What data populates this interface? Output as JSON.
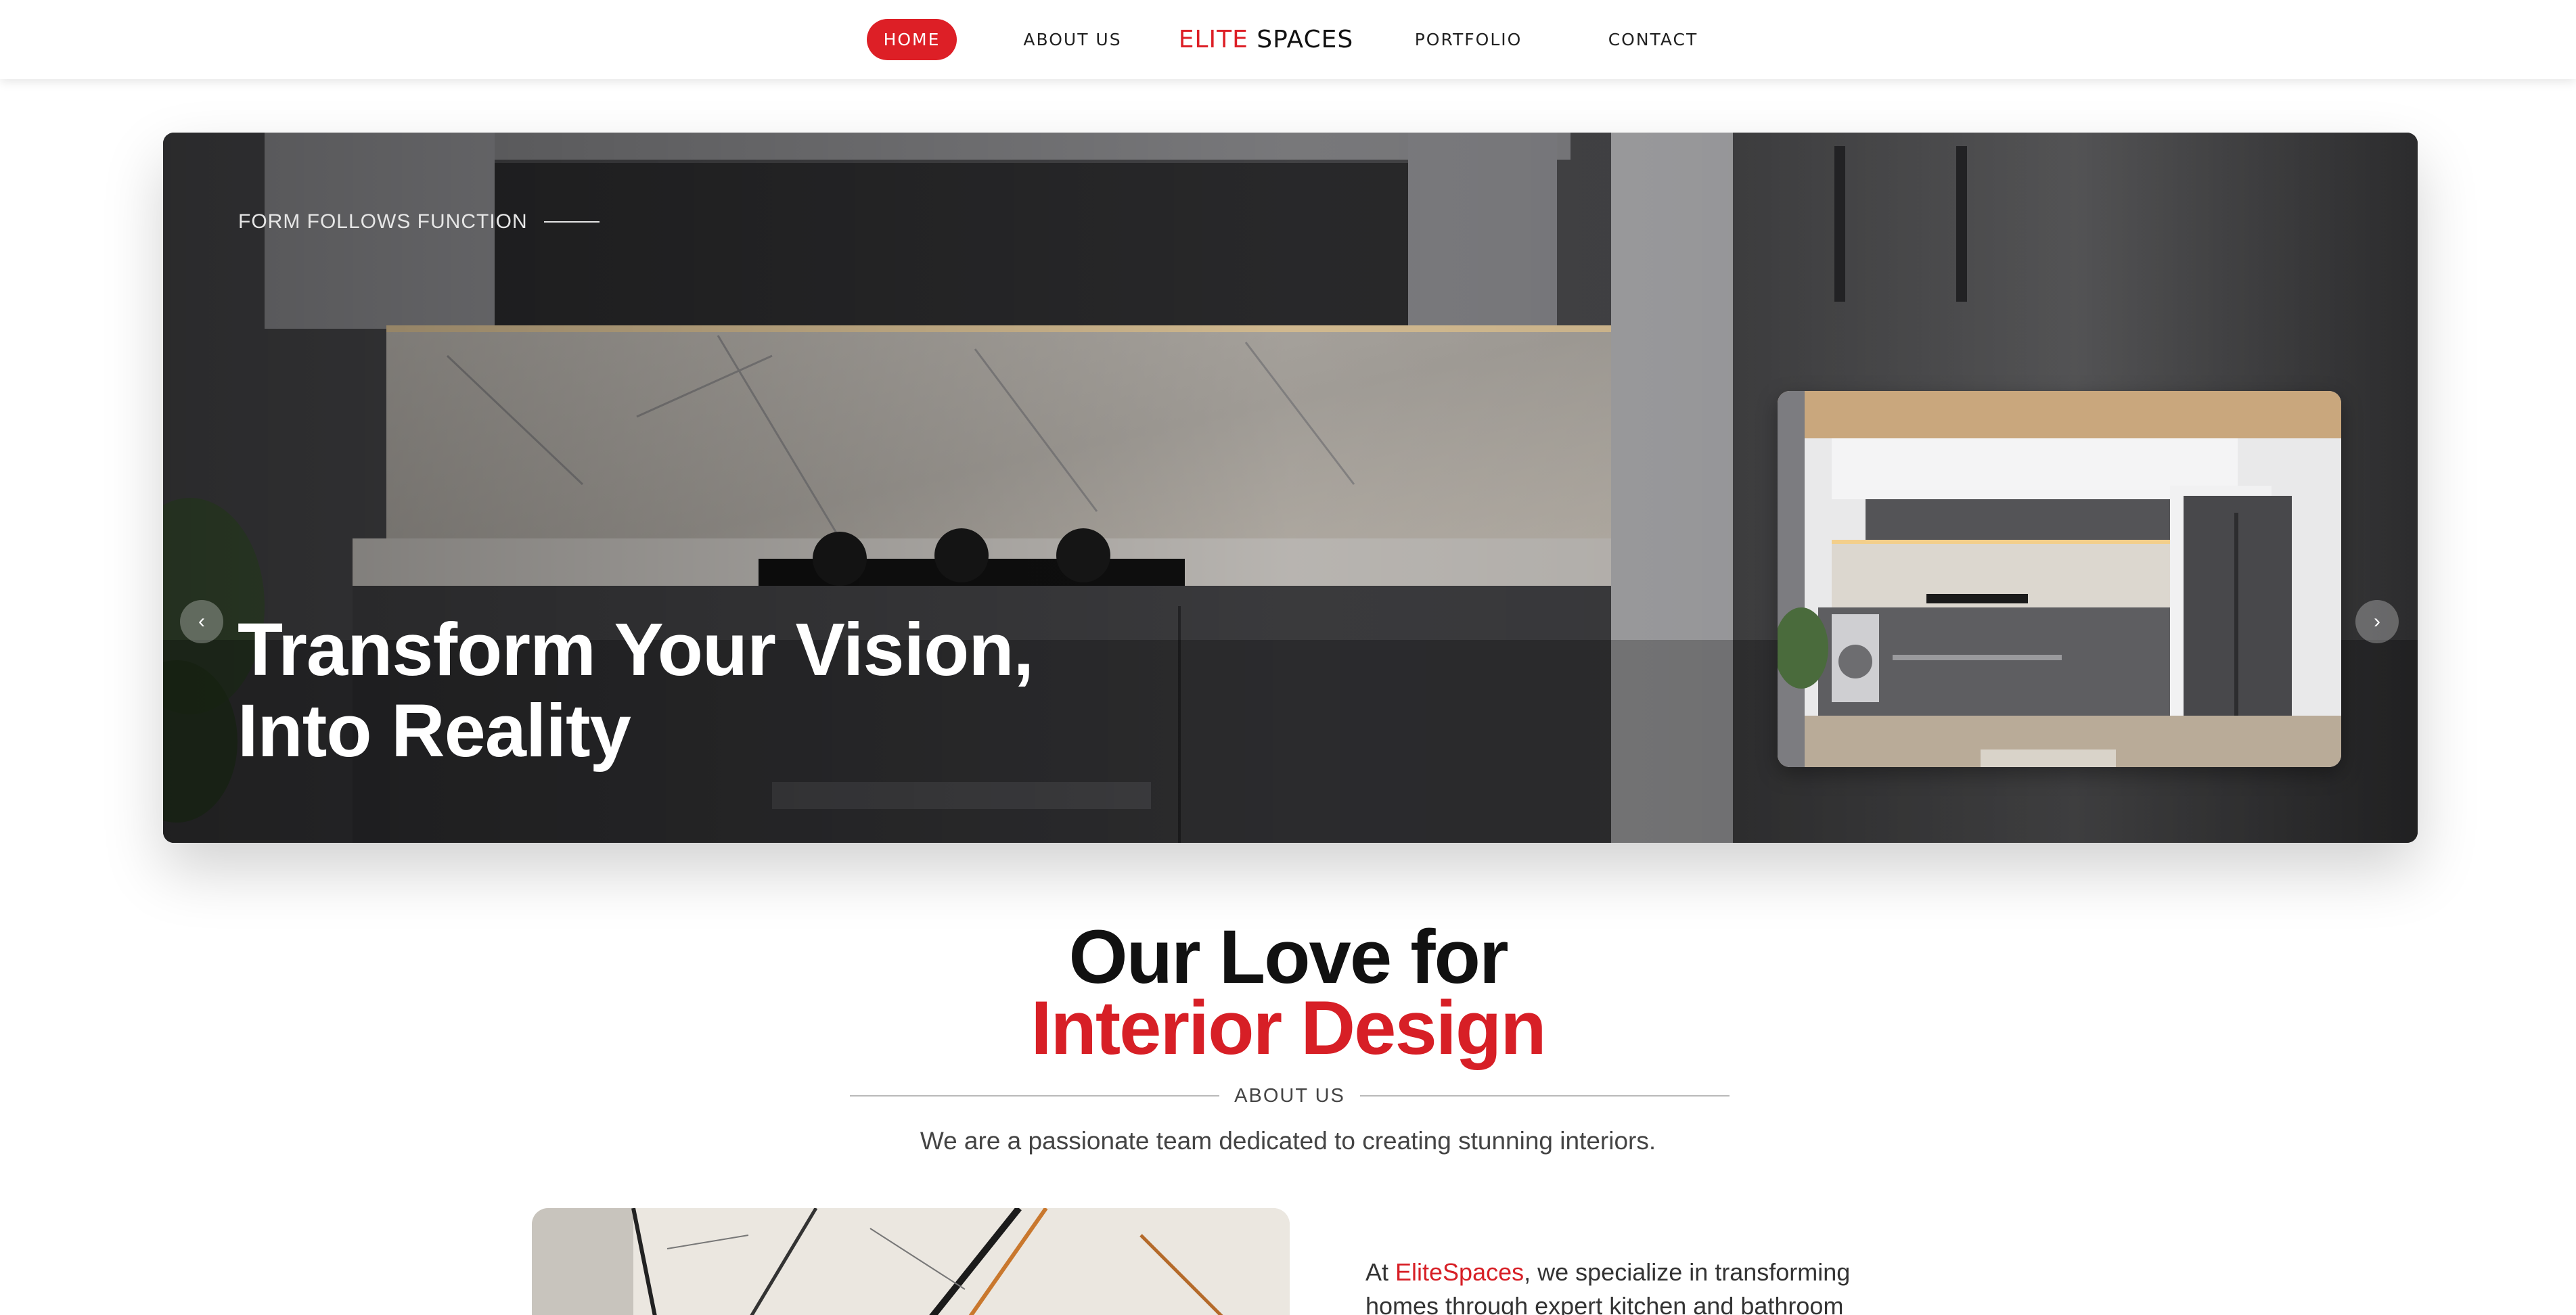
{
  "nav": {
    "home": "HOME",
    "about": "ABOUT US",
    "logo_part1": "ELITE",
    "logo_part2": "SPACES",
    "portfolio": "PORTFOLIO",
    "contact": "CONTACT",
    "active_color": "#dd1f26"
  },
  "hero": {
    "eyebrow": "FORM FOLLOWS FUNCTION",
    "title_line1": "Transform Your Vision,",
    "title_line2": "Into Reality",
    "prev_icon": "chevron-left-icon",
    "next_icon": "chevron-right-icon",
    "prev_glyph": "‹",
    "next_glyph": "›"
  },
  "about": {
    "title_line1": "Our Love for",
    "title_line2": "Interior Design",
    "label": "ABOUT US",
    "description": "We are a passionate team dedicated to creating stunning interiors.",
    "text_prefix": "At ",
    "brand": "EliteSpaces",
    "text_rest": ", we specialize in transforming homes through expert kitchen and bathroom",
    "accent_color": "#d71f26"
  }
}
